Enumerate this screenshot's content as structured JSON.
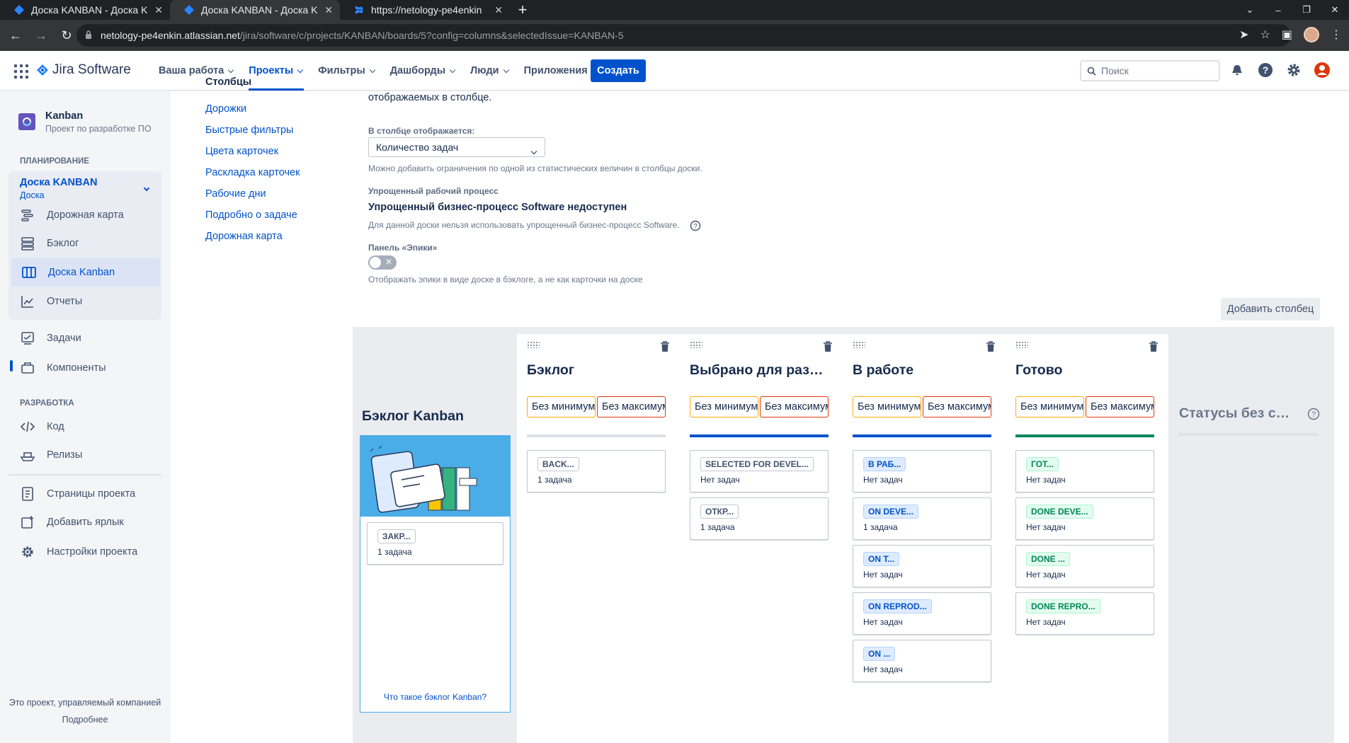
{
  "browser": {
    "tabs": [
      {
        "title": "Доска KANBAN - Доска Kanban",
        "active": false
      },
      {
        "title": "Доска KANBAN - Доска Kanban",
        "active": true
      },
      {
        "title": "https://netology-pe4enkin",
        "active": false
      }
    ],
    "url_host": "netology-pe4enkin.atlassian.net",
    "url_path": "/jira/software/c/projects/KANBAN/boards/5?config=columns&selectedIssue=KANBAN-5"
  },
  "header": {
    "product": "Jira Software",
    "nav": [
      "Ваша работа",
      "Проекты",
      "Фильтры",
      "Дашборды",
      "Люди",
      "Приложения"
    ],
    "create": "Создать",
    "search_placeholder": "Поиск"
  },
  "sidebar": {
    "project_name": "Kanban",
    "project_type": "Проект по разработке ПО",
    "planning": "ПЛАНИРОВАНИЕ",
    "board_name": "Доска KANBAN",
    "board_type": "Доска",
    "items": [
      "Дорожная карта",
      "Бэклог",
      "Доска Kanban",
      "Отчеты",
      "Задачи",
      "Компоненты"
    ],
    "dev": "РАЗРАБОТКА",
    "dev_items": [
      "Код",
      "Релизы"
    ],
    "bottom_items": [
      "Страницы проекта",
      "Добавить ярлык",
      "Настройки проекта"
    ],
    "footer": "Это проект, управляемый компанией",
    "footer_link": "Подробнее"
  },
  "settings_nav": {
    "cut_top": "Столбцы",
    "items": [
      "Дорожки",
      "Быстрые фильтры",
      "Цвета карточек",
      "Раскладка карточек",
      "Рабочие дни",
      "Подробно о задаче",
      "Дорожная карта"
    ]
  },
  "content": {
    "intro_tail": "отображаемых в столбце.",
    "column_display_label": "В столбце отображается:",
    "column_display_value": "Количество задач",
    "column_display_help": "Можно добавить ограничения по одной из статистических величин в столбцы доски.",
    "simplified_label": "Упрощенный рабочий процесс",
    "simplified_title": "Упрощенный бизнес-процесс Software недоступен",
    "simplified_help": "Для данной доски нельзя использовать упрощенный бизнес-процесс Software.",
    "epics_label": "Панель «Эпики»",
    "epics_help": "Отображать эпики в виде доске в бэклоге, а не как карточки на доске",
    "add_column": "Добавить столбец"
  },
  "board": {
    "backlog_title": "Бэклог Kanban",
    "backlog_status": {
      "label": "ЗАКР...",
      "count": "1 задача"
    },
    "backlog_footer": "Что такое бэклог Kanban?",
    "min_label": "Без минимума",
    "max_label": "Без максимума",
    "columns": [
      {
        "title": "Бэклог",
        "bar_color": "#dfe1e6",
        "statuses": [
          {
            "label": "BACK...",
            "color": "gray",
            "count": "1 задача"
          }
        ]
      },
      {
        "title": "Выбрано для разработки",
        "bar_color": "#0052cc",
        "statuses": [
          {
            "label": "SELECTED FOR DEVEL...",
            "color": "gray",
            "count": "Нет задач"
          },
          {
            "label": "ОТКР...",
            "color": "gray",
            "count": "1 задача"
          }
        ]
      },
      {
        "title": "В работе",
        "bar_color": "#0052cc",
        "statuses": [
          {
            "label": "В РАБ...",
            "color": "blue",
            "count": "Нет задач"
          },
          {
            "label": "ON DEVE...",
            "color": "blue",
            "count": "1 задача"
          },
          {
            "label": "ON T...",
            "color": "blue",
            "count": "Нет задач"
          },
          {
            "label": "ON REPROD...",
            "color": "blue",
            "count": "Нет задач"
          },
          {
            "label": "ON ...",
            "color": "blue",
            "count": "Нет задач"
          }
        ]
      },
      {
        "title": "Готово",
        "bar_color": "#00875a",
        "statuses": [
          {
            "label": "ГОТ...",
            "color": "green",
            "count": "Нет задач"
          },
          {
            "label": "DONE DEVE...",
            "color": "green",
            "count": "Нет задач"
          },
          {
            "label": "DONE ...",
            "color": "green",
            "count": "Нет задач"
          },
          {
            "label": "DONE REPRO...",
            "color": "green",
            "count": "Нет задач"
          }
        ]
      }
    ],
    "no_status_title": "Статусы без сопоставления"
  }
}
